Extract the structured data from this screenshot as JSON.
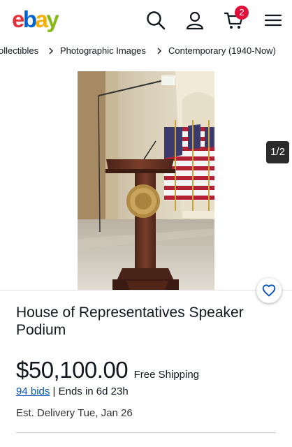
{
  "header": {
    "logo_letters": [
      {
        "char": "e",
        "color": "#e53238"
      },
      {
        "char": "b",
        "color": "#0064d2"
      },
      {
        "char": "a",
        "color": "#f5af02"
      },
      {
        "char": "y",
        "color": "#86b817"
      }
    ],
    "search_icon": "search-icon",
    "account_icon": "user-icon",
    "cart_icon": "cart-icon",
    "cart_count": "2",
    "menu_icon": "hamburger-menu-icon"
  },
  "breadcrumb": {
    "items": [
      "ollectibles",
      "Photographic Images",
      "Contemporary (1940-Now)"
    ],
    "separator_icon": "chevron-right-icon"
  },
  "gallery": {
    "counter": "1/2",
    "photo_alt": "Podium with US flags"
  },
  "listing": {
    "title": "House of Representatives Speaker Podium",
    "price": "$50,100.00",
    "shipping": "Free Shipping",
    "bids_link": "94 bids",
    "ends": "| Ends in 6d 23h",
    "delivery": "Est. Delivery Tue, Jan 26",
    "watch_icon": "heart-icon"
  },
  "colors": {
    "link": "#0654ba",
    "badge": "#e0103a",
    "text": "#111820"
  }
}
